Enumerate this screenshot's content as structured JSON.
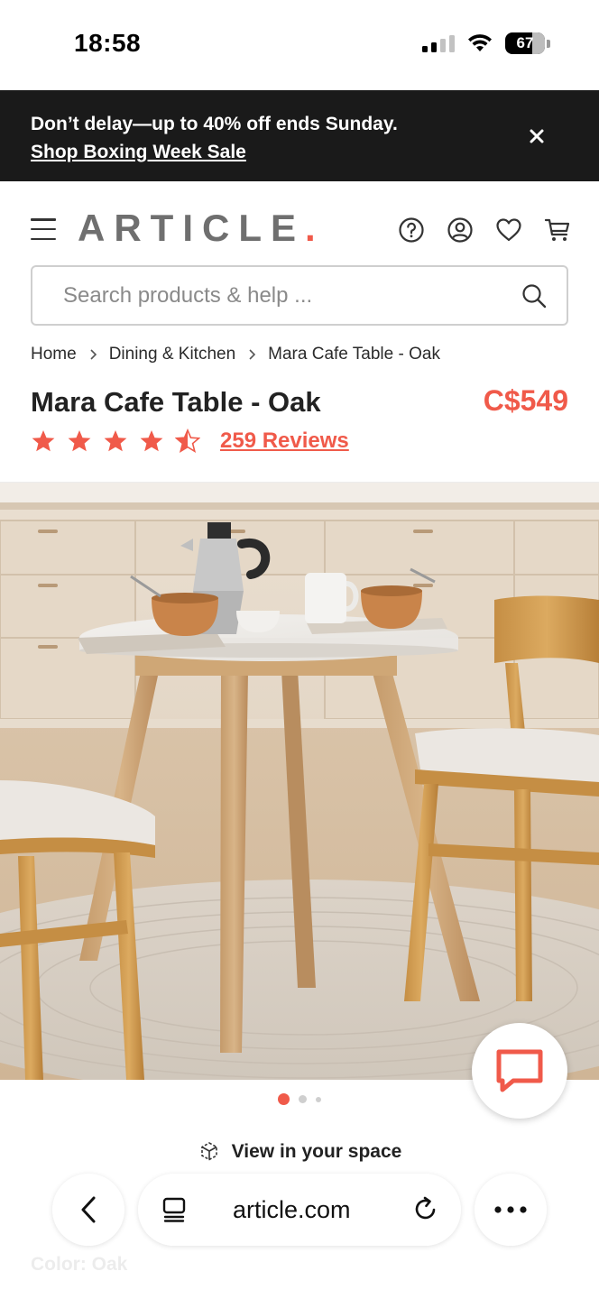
{
  "status_bar": {
    "time": "18:58",
    "battery": "67",
    "signal_bars": 2,
    "battery_level": 0.67
  },
  "promo": {
    "text": "Don’t delay—up to 40% off ends Sunday.",
    "link": "Shop Boxing Week Sale",
    "close_icon": "close-icon"
  },
  "header": {
    "logo_text": "ARTICLE",
    "logo_dot": ".",
    "icons": [
      "help-icon",
      "account-icon",
      "heart-icon",
      "cart-icon"
    ]
  },
  "search": {
    "placeholder": "Search products & help ...",
    "value": "",
    "icon": "search-icon"
  },
  "breadcrumb": [
    "Home",
    "Dining & Kitchen",
    "Mara Cafe Table - Oak"
  ],
  "product": {
    "title": "Mara Cafe Table - Oak",
    "price": "C$549",
    "rating": 4.5,
    "rating_max": 5,
    "reviews_label": "259 Reviews"
  },
  "gallery": {
    "image_count": 3,
    "active_index": 0
  },
  "view_in_space": "View in your space",
  "faded_label": "Color: Oak",
  "browser": {
    "url": "article.com",
    "icons": [
      "back-icon",
      "tabs-icon",
      "reload-icon",
      "more-icon"
    ]
  },
  "colors": {
    "accent": "#f05a4a",
    "banner_bg": "#1a1a1a",
    "logo_gray": "#6f6f6f"
  }
}
